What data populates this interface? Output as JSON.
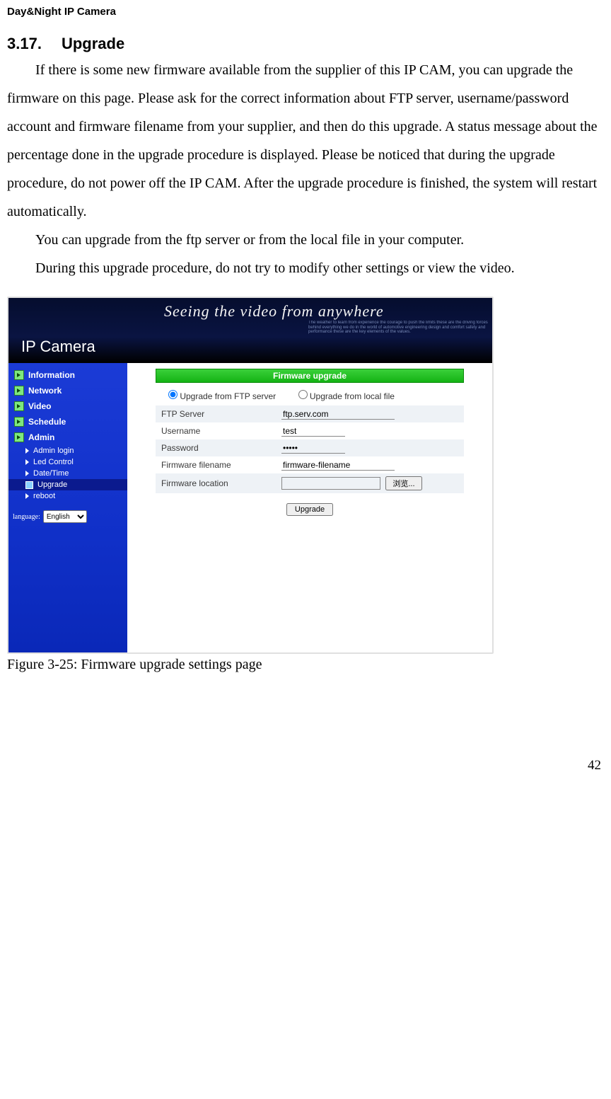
{
  "doc": {
    "running_head": "Day&Night IP Camera",
    "section_number": "3.17.",
    "section_title": "Upgrade",
    "para1": "If there is some new firmware available from the supplier of this IP CAM, you can upgrade the firmware on this page. Please ask for the correct information about FTP server, username/password account and firmware filename from your supplier, and then do this upgrade. A status message about the percentage done in the upgrade procedure is displayed. Please be noticed that during the upgrade procedure, do not power off the IP CAM. After the upgrade procedure is finished, the system will restart automatically.",
    "para2": "You can upgrade from the ftp server or from the local file in your computer.",
    "para3": "During this upgrade procedure, do not try to modify other settings or view the video.",
    "figure_caption": "Figure 3-25: Firmware upgrade settings page",
    "page_number": "42"
  },
  "screenshot": {
    "banner_script": "Seeing the video from anywhere",
    "banner_logo": "IP Camera",
    "nav": {
      "top": [
        "Information",
        "Network",
        "Video",
        "Schedule",
        "Admin"
      ],
      "sub": [
        "Admin login",
        "Led Control",
        "Date/Time",
        "Upgrade",
        "reboot"
      ],
      "active_sub_index": 3
    },
    "language_label": "language:",
    "language_value": "English",
    "panel_title": "Firmware upgrade",
    "radio": {
      "ftp": "Upgrade from FTP server",
      "local": "Upgrade from local file",
      "selected": "ftp"
    },
    "fields": {
      "ftp_server_label": "FTP Server",
      "ftp_server_value": "ftp.serv.com",
      "username_label": "Username",
      "username_value": "test",
      "password_label": "Password",
      "password_value": "•••••",
      "fw_filename_label": "Firmware filename",
      "fw_filename_value": "firmware-filename",
      "fw_location_label": "Firmware location",
      "fw_location_value": ""
    },
    "browse_button": "浏览...",
    "upgrade_button": "Upgrade"
  }
}
